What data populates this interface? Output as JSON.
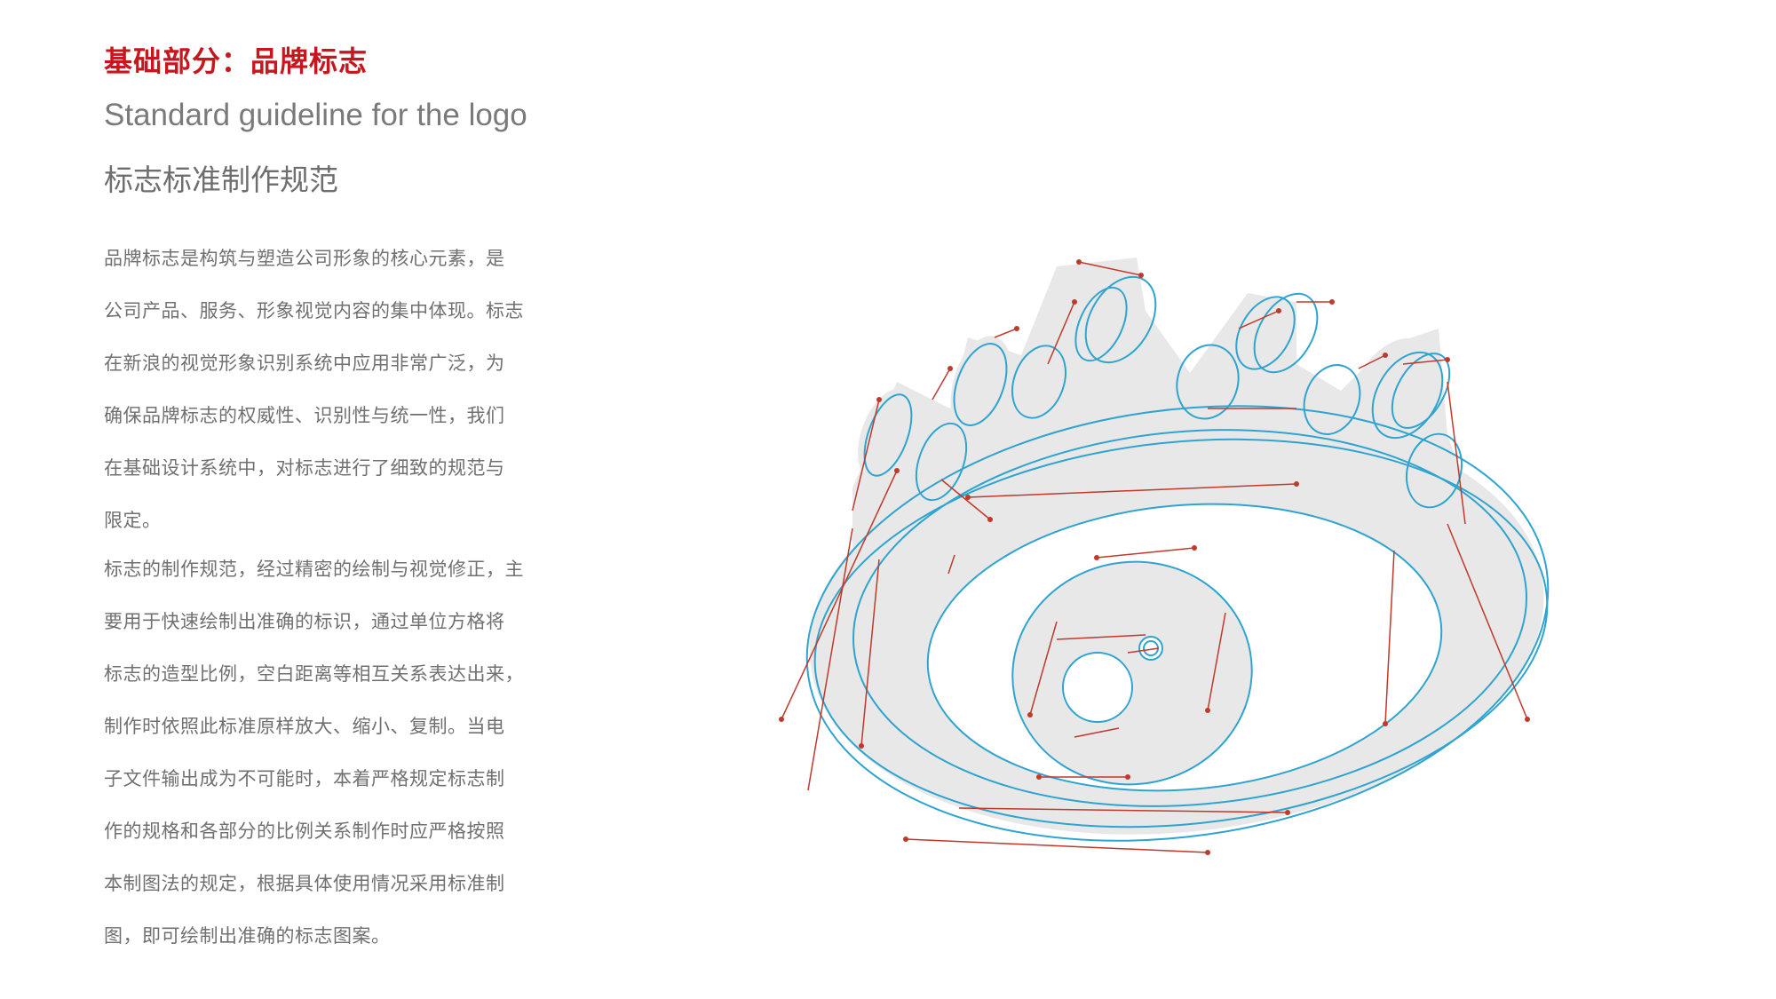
{
  "header": {
    "title": "基础部分：品牌标志",
    "subtitle_en": "Standard guideline for the logo",
    "subtitle_cn": "标志标准制作规范"
  },
  "body": {
    "paragraph_1": [
      "品牌标志是构筑与塑造公司形象的核心元素，是",
      "公司产品、服务、形象视觉内容的集中体现。标志",
      "在新浪的视觉形象识别系统中应用非常广泛，为",
      "确保品牌标志的权威性、识别性与统一性，我们",
      "在基础设计系统中，对标志进行了细致的规范与",
      "限定。"
    ],
    "paragraph_2": [
      "标志的制作规范，经过精密的绘制与视觉修正，主",
      "要用于快速绘制出准确的标识，通过单位方格将",
      "标志的造型比例，空白距离等相互关系表达出来，",
      "制作时依照此标准原样放大、缩小、复制。当电",
      "子文件输出成为不可能时，本着严格规定标志制",
      "作的规格和各部分的比例关系制作时应严格按照",
      "本制图法的规定，根据具体使用情况采用标准制",
      "图，即可绘制出准确的标志图案。"
    ]
  },
  "figure": {
    "fill_color": "#e8e8e8",
    "construction_color": "#2fa4d0",
    "anchor_color": "#c0392b",
    "accent_color": "#c8161e"
  }
}
